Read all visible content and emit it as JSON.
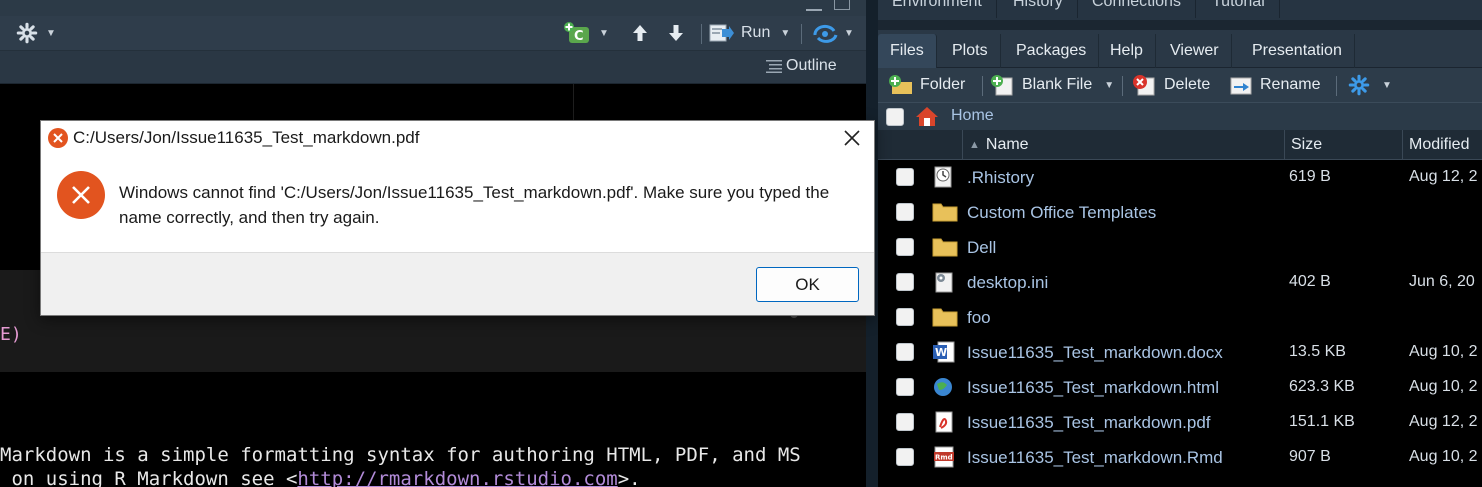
{
  "editor": {
    "toolbar": {
      "run_label": "Run",
      "outline_label": "Outline"
    },
    "chunk_fragment": "E)",
    "markdown_line1": "Markdown is a simple formatting syntax for authoring HTML, PDF, and MS",
    "markdown_line2_prefix": " on using R Markdown see <",
    "markdown_link": "http://rmarkdown.rstudio.com",
    "markdown_line2_suffix": ">."
  },
  "right_pane": {
    "env_tabs": [
      "Environment",
      "History",
      "Connections",
      "Tutorial"
    ],
    "tabs": [
      "Files",
      "Plots",
      "Packages",
      "Help",
      "Viewer",
      "Presentation"
    ],
    "active_tab": "Files",
    "toolbar": {
      "folder": "Folder",
      "blank_file": "Blank File",
      "delete": "Delete",
      "rename": "Rename"
    },
    "breadcrumb": "Home",
    "columns": {
      "name": "Name",
      "size": "Size",
      "modified": "Modified"
    },
    "files": [
      {
        "name": ".Rhistory",
        "size": "619 B",
        "modified": "Aug 12, 2",
        "icon": "history-file-icon"
      },
      {
        "name": "Custom Office Templates",
        "size": "",
        "modified": "",
        "icon": "folder-icon"
      },
      {
        "name": "Dell",
        "size": "",
        "modified": "",
        "icon": "folder-icon"
      },
      {
        "name": "desktop.ini",
        "size": "402 B",
        "modified": "Jun 6, 20",
        "icon": "settings-file-icon"
      },
      {
        "name": "foo",
        "size": "",
        "modified": "",
        "icon": "folder-icon"
      },
      {
        "name": "Issue11635_Test_markdown.docx",
        "size": "13.5 KB",
        "modified": "Aug 10, 2",
        "icon": "word-file-icon"
      },
      {
        "name": "Issue11635_Test_markdown.html",
        "size": "623.3 KB",
        "modified": "Aug 10, 2",
        "icon": "html-file-icon"
      },
      {
        "name": "Issue11635_Test_markdown.pdf",
        "size": "151.1 KB",
        "modified": "Aug 12, 2",
        "icon": "pdf-file-icon"
      },
      {
        "name": "Issue11635_Test_markdown.Rmd",
        "size": "907 B",
        "modified": "Aug 10, 2",
        "icon": "rmd-file-icon"
      }
    ]
  },
  "dialog": {
    "title": "C:/Users/Jon/Issue11635_Test_markdown.pdf",
    "message": "Windows cannot find 'C:/Users/Jon/Issue11635_Test_markdown.pdf'. Make sure you typed the name correctly, and then try again.",
    "ok_label": "OK"
  },
  "colors": {
    "error_red": "#e2541f",
    "link_blue": "#a9c4e4",
    "accent_blue": "#0067c0"
  }
}
